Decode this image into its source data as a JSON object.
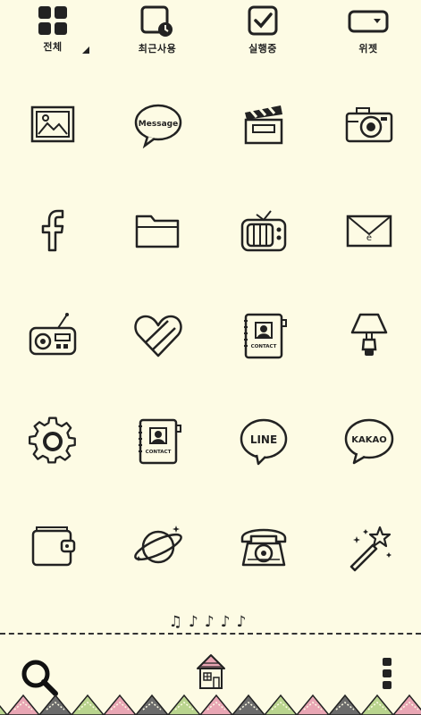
{
  "tabs": [
    {
      "label": "전체",
      "icon": "grid-icon"
    },
    {
      "label": "최근사용",
      "icon": "recent-icon"
    },
    {
      "label": "실행중",
      "icon": "running-check-icon"
    },
    {
      "label": "위젯",
      "icon": "widget-icon"
    }
  ],
  "apps": [
    {
      "name": "gallery",
      "icon": "gallery-icon"
    },
    {
      "name": "message",
      "icon": "message-bubble-icon",
      "text": "Message"
    },
    {
      "name": "video",
      "icon": "clapperboard-icon"
    },
    {
      "name": "camera",
      "icon": "camera-icon"
    },
    {
      "name": "facebook",
      "icon": "facebook-icon",
      "text": "f"
    },
    {
      "name": "files",
      "icon": "folder-icon"
    },
    {
      "name": "tv",
      "icon": "tv-icon"
    },
    {
      "name": "email",
      "icon": "envelope-icon",
      "text": "e"
    },
    {
      "name": "radio",
      "icon": "radio-icon"
    },
    {
      "name": "favorites",
      "icon": "heart-icon"
    },
    {
      "name": "contacts",
      "icon": "contact-book-icon",
      "text": "CONTACT"
    },
    {
      "name": "lamp",
      "icon": "lamp-icon"
    },
    {
      "name": "settings",
      "icon": "gear-icon"
    },
    {
      "name": "contacts-2",
      "icon": "contact-book-icon",
      "text": "CONTACT"
    },
    {
      "name": "line",
      "icon": "line-bubble-icon",
      "text": "LINE"
    },
    {
      "name": "kakao",
      "icon": "kakao-bubble-icon",
      "text": "KAKAO"
    },
    {
      "name": "wallet",
      "icon": "wallet-icon"
    },
    {
      "name": "planet",
      "icon": "planet-icon"
    },
    {
      "name": "phone",
      "icon": "telephone-icon"
    },
    {
      "name": "magic-wand",
      "icon": "magic-wand-icon"
    }
  ],
  "decor": {
    "notes": "♫♪♪♪♪"
  },
  "dock": {
    "search_icon": "search-icon",
    "home_icon": "house-icon",
    "menu_icon": "more-vertical-icon"
  },
  "colors": {
    "background": "#fdfbe4",
    "ink": "#222222",
    "zigzag": [
      "#e9a6b4",
      "#6b6b6b",
      "#b9d48e"
    ]
  }
}
